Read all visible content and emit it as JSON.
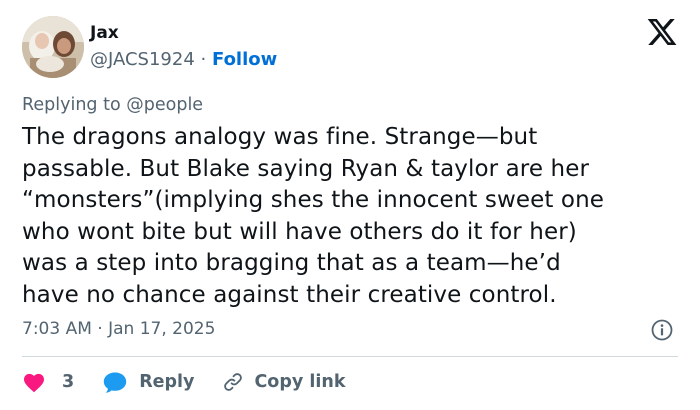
{
  "author": {
    "name": "Jax",
    "handle": "@JACS1924",
    "separator": "·",
    "follow_label": "Follow"
  },
  "reply_context": {
    "prefix": "Replying to",
    "mention": "@people"
  },
  "tweet": {
    "text": "The dragons analogy was fine. Strange—but\npassable. But Blake saying Ryan & taylor are her\n“monsters”(implying shes the innocent sweet one\nwho wont bite but will have others do it for her)\nwas a step into bragging that as a team—he’d\nhave no chance against their creative control.",
    "timestamp": "7:03 AM · Jan 17, 2025"
  },
  "actions": {
    "like_count": "3",
    "reply_label": "Reply",
    "copy_link_label": "Copy link"
  },
  "icons": {
    "logo": "x-logo-icon",
    "info": "info-icon",
    "like": "heart-icon",
    "reply": "speech-bubble-icon",
    "copy": "link-icon"
  },
  "colors": {
    "text": "#0f1419",
    "secondary": "#536471",
    "link": "#006fd6",
    "heart": "#f91880",
    "reply_bubble": "#1d9bf0",
    "divider": "#cfd9de"
  }
}
